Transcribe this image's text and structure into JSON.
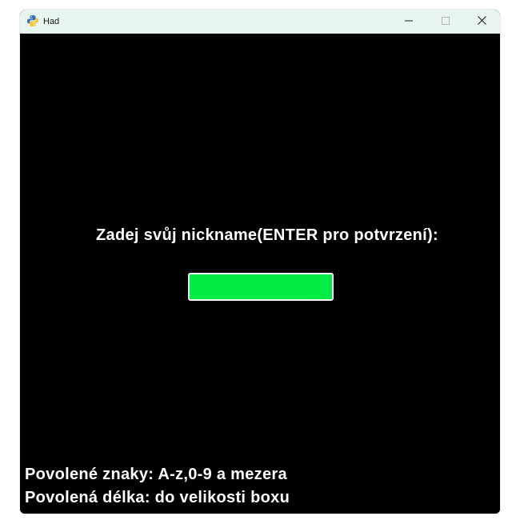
{
  "window": {
    "title": "Had",
    "icon": "python-snake-icon",
    "controls": {
      "minimize_icon": "minimize-icon",
      "maximize_icon": "maximize-icon",
      "close_icon": "close-icon"
    }
  },
  "game": {
    "prompt": "Zadej svůj nickname(ENTER pro potvrzení):",
    "nickname_value": "",
    "allowed_chars": "Povolené znaky: A-z,0-9 a mezera",
    "allowed_length": "Povolená délka: do velikosti boxu"
  },
  "colors": {
    "background": "#000000",
    "input_fill": "#00ee44",
    "input_border": "#ffffff",
    "text": "#ffffff",
    "titlebar": "#e8f4ee"
  }
}
